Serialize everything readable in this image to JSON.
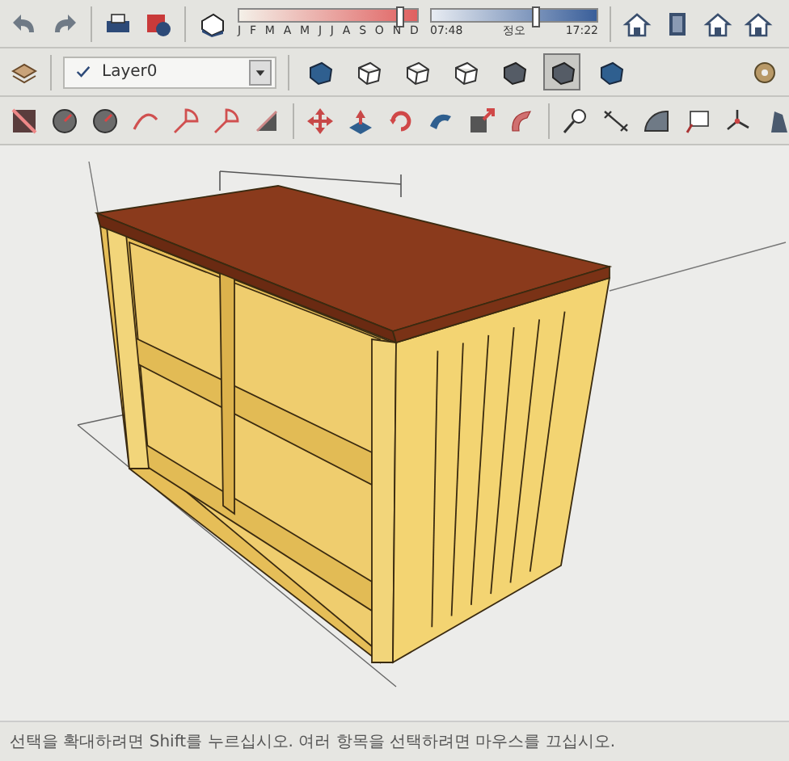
{
  "toolbar_top": {
    "month_slider": {
      "months": [
        "J",
        "F",
        "M",
        "A",
        "M",
        "J",
        "J",
        "A",
        "S",
        "O",
        "N",
        "D"
      ],
      "level": 0.9
    },
    "time_slider": {
      "start": "07:48",
      "middle": "정오",
      "end": "17:22",
      "level": 0.63
    }
  },
  "layer_toolbar": {
    "layer": {
      "checked": true,
      "value": "Layer0"
    }
  },
  "style_buttons": [
    {
      "selected": false
    },
    {
      "selected": false
    },
    {
      "selected": false
    },
    {
      "selected": false
    },
    {
      "selected": false
    },
    {
      "selected": true
    },
    {
      "selected": false
    }
  ],
  "status_bar": {
    "text": "선택을 확대하려면 Shift를 누르십시오. 여러 항목을 선택하려면 마우스를 끄십시오."
  }
}
